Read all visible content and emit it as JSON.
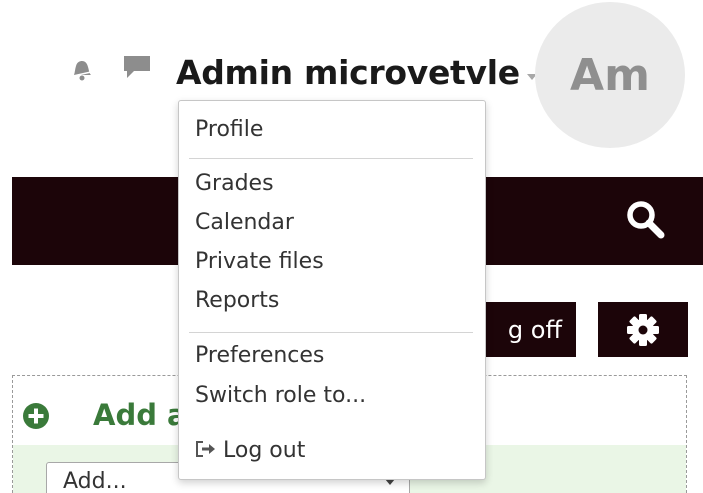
{
  "header": {
    "username": "Admin microvetvle",
    "avatar_initials": "Am",
    "notification_icon": "bell-icon",
    "messages_icon": "chat-bubble-icon"
  },
  "navbar": {
    "search_icon": "search-icon"
  },
  "actions": {
    "edit_toggle_label": "g off",
    "settings_icon": "gear-icon"
  },
  "add_block": {
    "title": "Add a",
    "select_value": "Add..."
  },
  "user_menu": {
    "items": [
      {
        "label": "Profile"
      },
      {
        "label": "Grades"
      },
      {
        "label": "Calendar"
      },
      {
        "label": "Private files"
      },
      {
        "label": "Reports"
      },
      {
        "label": "Preferences"
      },
      {
        "label": "Switch role to..."
      },
      {
        "label": "Log out",
        "icon": "logout-icon"
      }
    ]
  },
  "colors": {
    "navbar_bg": "#1c0509",
    "block_band_bg": "#eaf6e6",
    "accent_green": "#3a7a3a",
    "avatar_bg": "#ebebeb"
  }
}
